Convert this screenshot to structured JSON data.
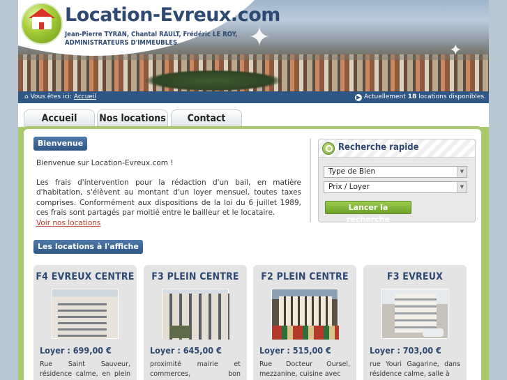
{
  "header": {
    "site_title": "Location-Evreux.com",
    "subtitle_line1": "Jean-Pierre TYRAN, Chantal RAULT, Frédéric LE ROY,",
    "subtitle_line2": "ADMINISTRATEURS D'IMMEUBLES"
  },
  "infobar": {
    "you_are_here": "Vous êtes ici:",
    "breadcrumb": "Accueil",
    "available_prefix": "Actuellement",
    "available_count": "18",
    "available_suffix": "locations disponibles."
  },
  "tabs": [
    {
      "label": "Accueil"
    },
    {
      "label": "Nos locations"
    },
    {
      "label": "Contact"
    }
  ],
  "welcome": {
    "badge": "Bienvenue",
    "greeting": "Bienvenue sur Location-Evreux.com !",
    "body": "Les frais d'intervention pour la rédaction d'un bail, en matière d'habitation, s'élèvent au montant d'un loyer mensuel, toutes taxes comprises. Conformément aux dispositions de la loi du 6 juillet 1989, ces frais sont partagés par moitié entre le bailleur et le locataire.",
    "link": "Voir nos locations"
  },
  "search": {
    "title": "Recherche rapide",
    "type_select": "Type de Bien",
    "price_select": "Prix / Loyer",
    "button": "Lancer la recherche"
  },
  "featured": {
    "badge": "Les locations à l'affiche",
    "cards": [
      {
        "title": "F4 EVREUX CENTRE",
        "price": "Loyer : 699,00 €",
        "desc": "Rue Saint Sauveur, résidence calme, en plein centre ville,"
      },
      {
        "title": "F3 PLEIN CENTRE",
        "price": "Loyer : 645,00 €",
        "desc": "proximité mairie et commerces, bon état.FRAIS"
      },
      {
        "title": "F2 PLEIN CENTRE",
        "price": "Loyer : 515,00 €",
        "desc": "Rue Docteur Oursel, mezzanine, cuisine avec"
      },
      {
        "title": "F3 EVREUX",
        "price": "Loyer : 703,00 €",
        "desc": "rue Youri Gagarine, dans résidence calme, salle à"
      }
    ]
  }
}
